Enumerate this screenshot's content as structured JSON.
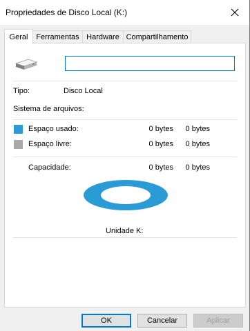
{
  "window": {
    "title": "Propriedades de Disco Local (K:)"
  },
  "tabs": [
    {
      "label": "Geral",
      "active": true
    },
    {
      "label": "Ferramentas",
      "active": false
    },
    {
      "label": "Hardware",
      "active": false
    },
    {
      "label": "Compartilhamento",
      "active": false
    }
  ],
  "general": {
    "name_value": "",
    "type_label": "Tipo:",
    "type_value": "Disco Local",
    "filesystem_label": "Sistema de arquivos:",
    "filesystem_value": "",
    "used": {
      "label": "Espaço usado:",
      "bytes": "0 bytes",
      "size": "0 bytes",
      "color": "#2b9bd6"
    },
    "free": {
      "label": "Espaço livre:",
      "bytes": "0 bytes",
      "size": "0 bytes",
      "color": "#a9a9a9"
    },
    "capacity": {
      "label": "Capacidade:",
      "bytes": "0 bytes",
      "size": "0 bytes"
    },
    "drive_label": "Unidade K:"
  },
  "buttons": {
    "ok": "OK",
    "cancel": "Cancelar",
    "apply": "Aplicar"
  },
  "icons": {
    "close": "close-icon",
    "drive": "drive-icon"
  }
}
